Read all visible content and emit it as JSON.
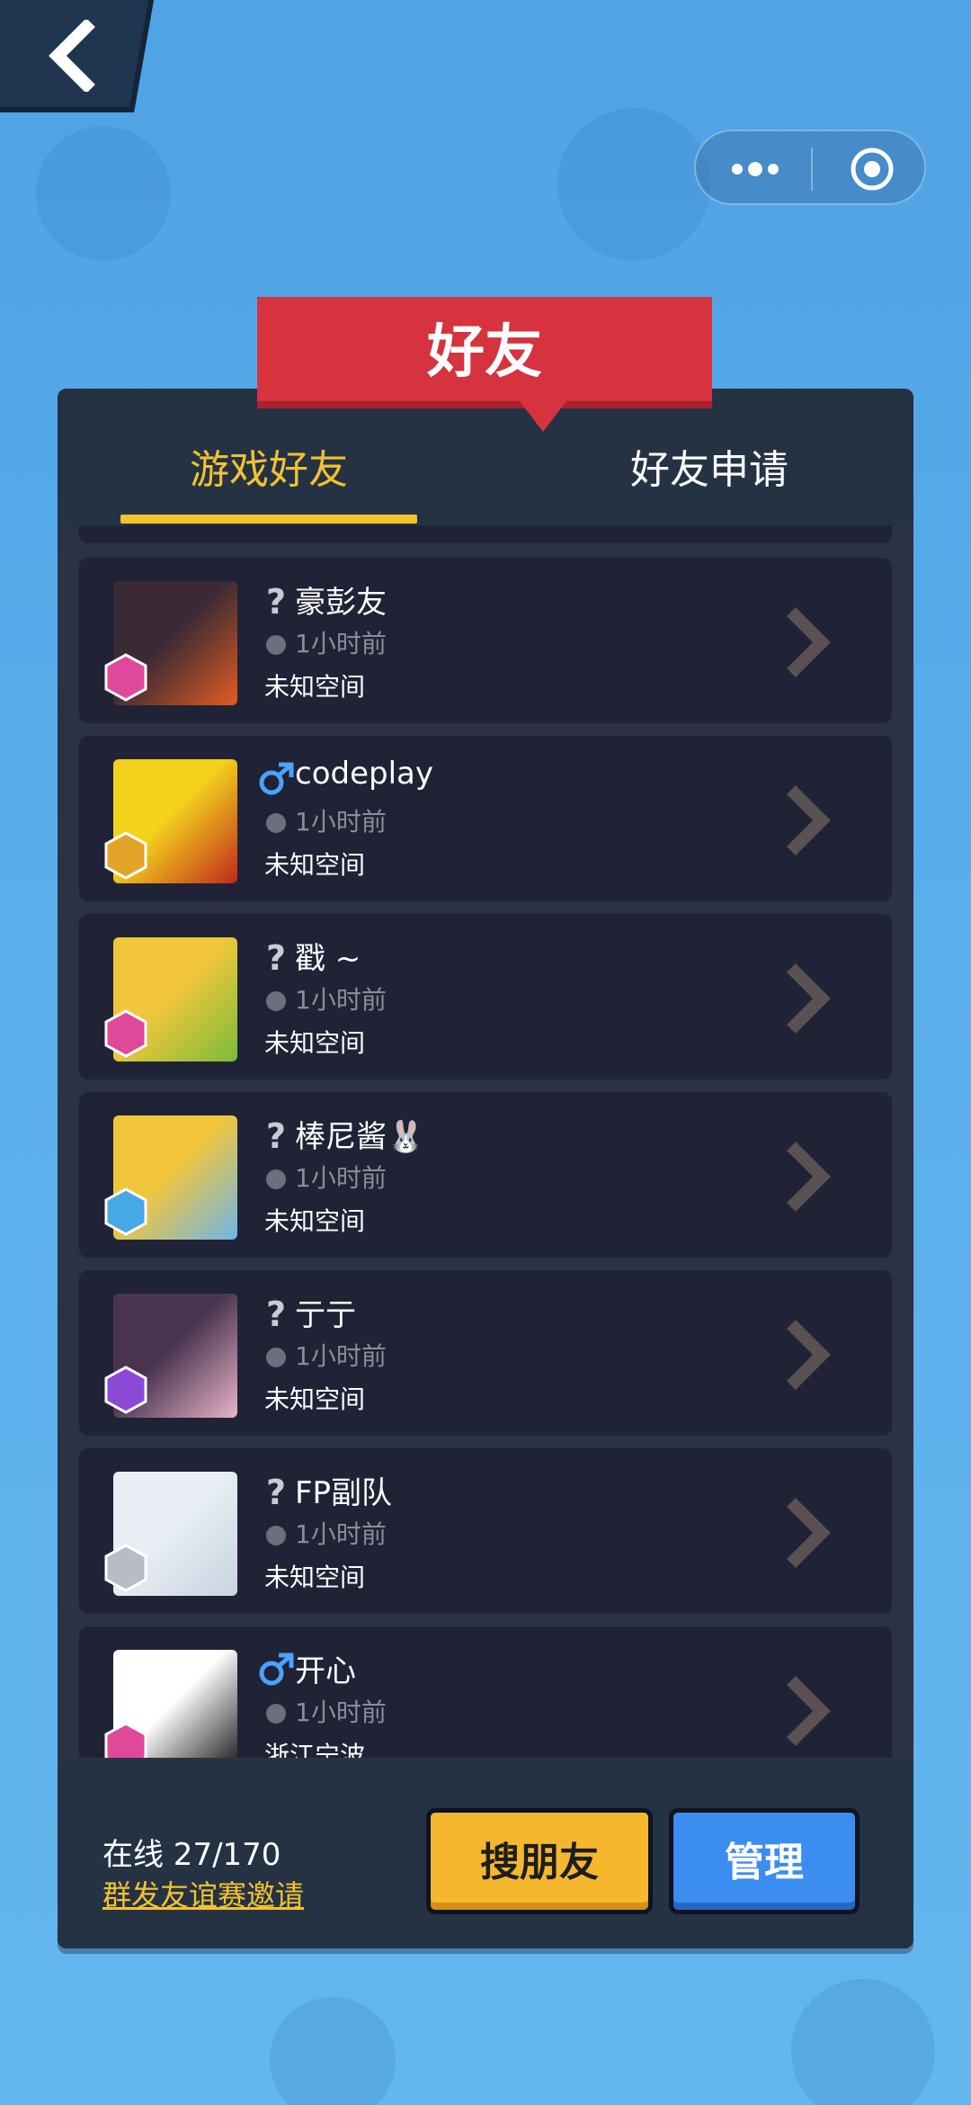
{
  "header": {
    "title": "好友"
  },
  "tabs": [
    {
      "label": "游戏好友",
      "active": true
    },
    {
      "label": "好友申请",
      "active": false
    }
  ],
  "friends": [
    {
      "gender": "unknown",
      "gender_icon": "question-icon",
      "name": "豪彭友",
      "last_seen": "1小时前",
      "location": "未知空间",
      "avatar_colors": [
        "#3a2a35",
        "#e25c22"
      ],
      "badge": "pink-gem-icon"
    },
    {
      "gender": "male",
      "gender_icon": "male-icon",
      "name": "codeplay",
      "last_seen": "1小时前",
      "location": "未知空间",
      "avatar_colors": [
        "#f2d21c",
        "#c0281c"
      ],
      "badge": "gold-crown-icon"
    },
    {
      "gender": "unknown",
      "gender_icon": "question-icon",
      "name": "戳 ~",
      "last_seen": "1小时前",
      "location": "未知空间",
      "avatar_colors": [
        "#f2c63b",
        "#7cbc3b"
      ],
      "badge": "pink-gem-icon"
    },
    {
      "gender": "unknown",
      "gender_icon": "question-icon",
      "name": "棒尼酱🐰",
      "last_seen": "1小时前",
      "location": "未知空间",
      "avatar_colors": [
        "#f2c63b",
        "#6fb5e8"
      ],
      "badge": "blue-gem-icon"
    },
    {
      "gender": "unknown",
      "gender_icon": "question-icon",
      "name": "亍亍",
      "last_seen": "1小时前",
      "location": "未知空间",
      "avatar_colors": [
        "#4a3450",
        "#e8b4c8"
      ],
      "badge": "purple-gem-icon"
    },
    {
      "gender": "unknown",
      "gender_icon": "question-icon",
      "name": "FP副队",
      "last_seen": "1小时前",
      "location": "未知空间",
      "avatar_colors": [
        "#e8eef4",
        "#c8d4e0"
      ],
      "badge": "grey-shield-icon"
    },
    {
      "gender": "male",
      "gender_icon": "male-icon",
      "name": "开心",
      "last_seen": "1小时前",
      "location": "浙江宁波",
      "avatar_colors": [
        "#ffffff",
        "#111111"
      ],
      "badge": "pink-gem-icon"
    }
  ],
  "footer": {
    "online_label": "在线 27/170",
    "invite_link": "群发友谊赛邀请",
    "search_button": "搜朋友",
    "manage_button": "管理"
  },
  "colors": {
    "accent_yellow": "#f2c230",
    "ribbon_red": "#d6333e",
    "manage_blue": "#3b8df0",
    "search_orange": "#f5b72e"
  }
}
